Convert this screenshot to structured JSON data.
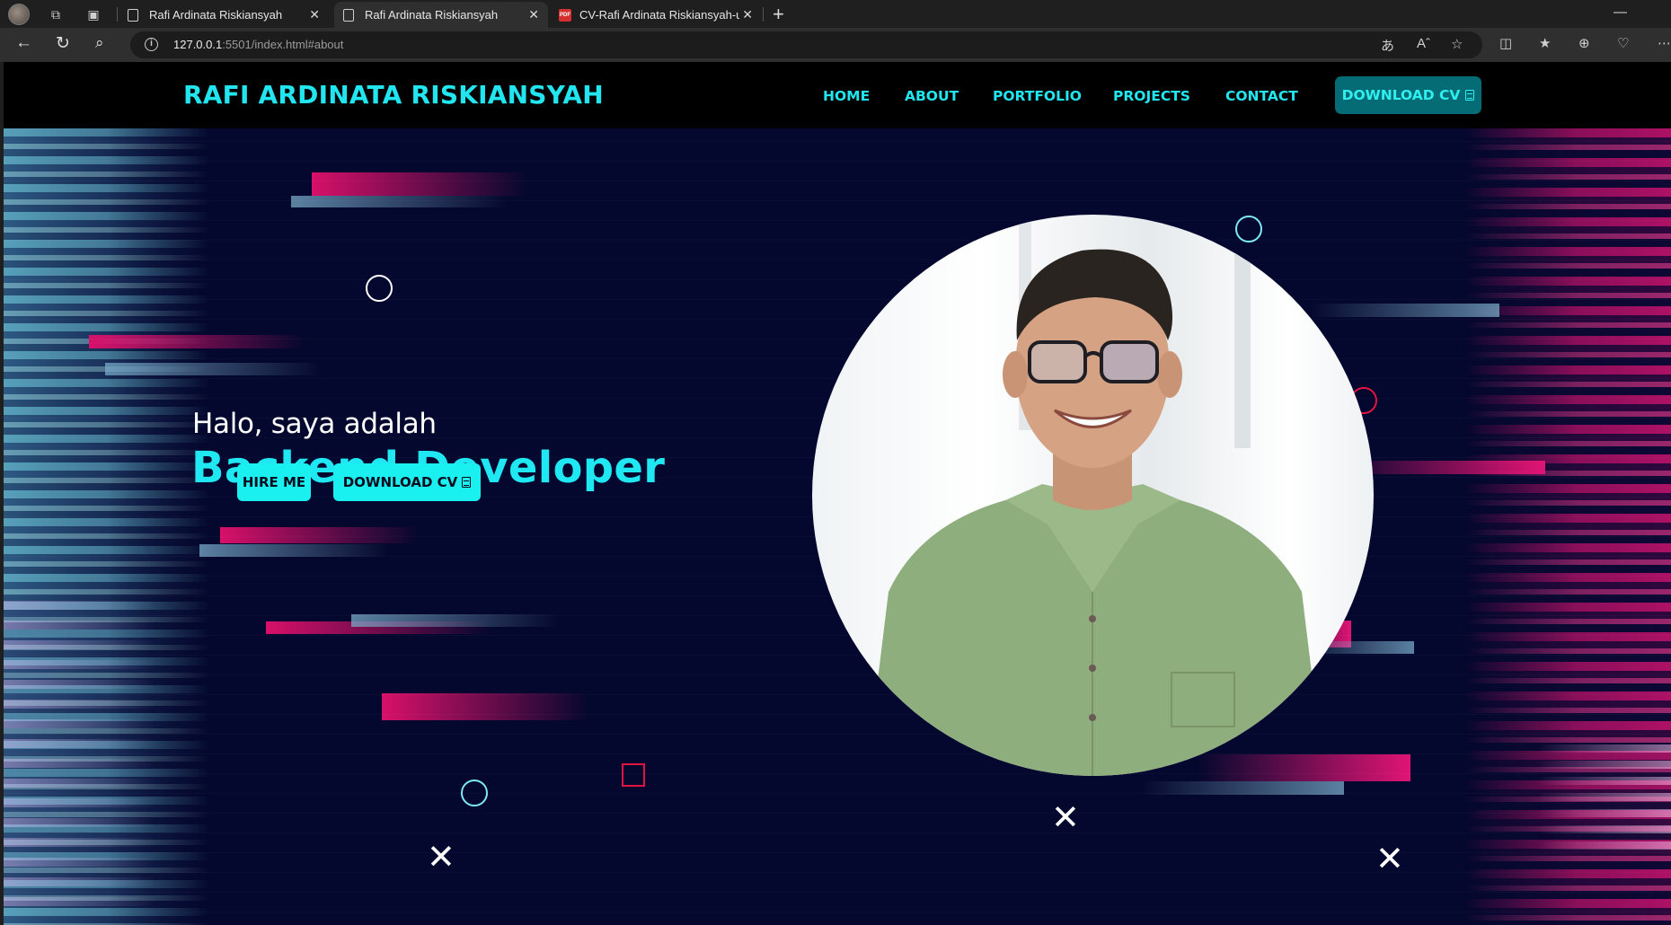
{
  "browser": {
    "tabs": [
      {
        "title": "Rafi Ardinata Riskiansyah",
        "icon": "document-icon",
        "active": false
      },
      {
        "title": "Rafi Ardinata Riskiansyah",
        "icon": "document-icon",
        "active": true
      },
      {
        "title": "CV-Rafi Ardinata Riskiansyah-up",
        "icon": "pdf-icon",
        "active": false
      }
    ],
    "url_host": "127.0.0.1",
    "url_rest": ":5501/index.html#about",
    "accent": "#21e6f0"
  },
  "site": {
    "brand": "RAFI ARDINATA RISKIANSYAH",
    "nav": [
      "HOME",
      "ABOUT",
      "PORTFOLIO",
      "PROJECTS",
      "CONTACT"
    ],
    "nav_cv_label": "DOWNLOAD CV"
  },
  "hero": {
    "greeting": "Halo, saya adalah",
    "role": "Backend Developer",
    "hire_label": "HIRE ME",
    "cv_label": "DOWNLOAD CV",
    "colors": {
      "background": "#05082e",
      "cyan": "#1fe8f2",
      "pink": "#d8106a",
      "square": "#e0153f"
    }
  }
}
